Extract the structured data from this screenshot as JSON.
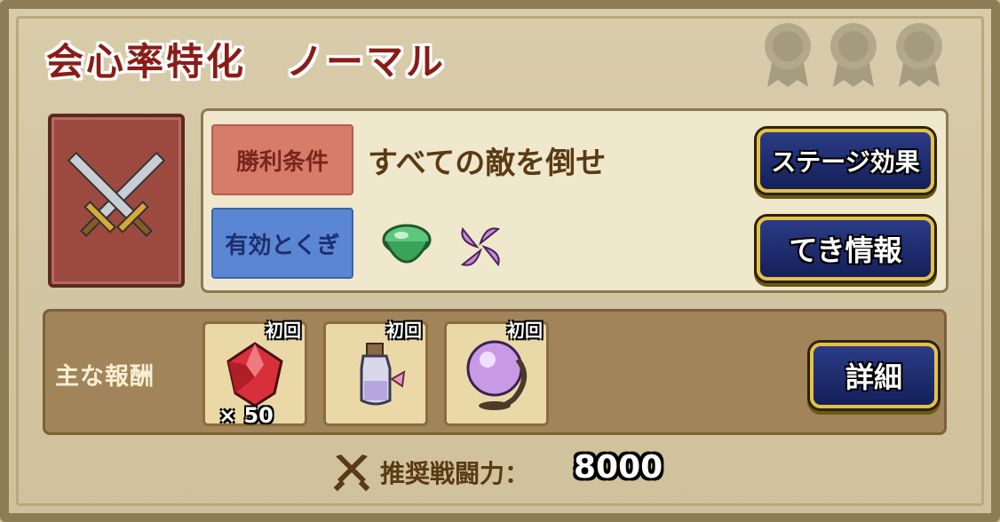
{
  "header": {
    "title": "会心率特化　ノーマル",
    "medals": [
      "medal",
      "medal",
      "medal"
    ]
  },
  "stage": {
    "icon": "crossed-swords-icon"
  },
  "conditions": {
    "win_label": "勝利条件",
    "win_text": "すべての敵を倒せ",
    "skill_label": "有効とくぎ",
    "skills": [
      "green-drop-icon",
      "purple-pinwheel-icon"
    ]
  },
  "buttons": {
    "stage_effect": "ステージ効果",
    "enemy_info": "てき情報",
    "detail": "詳細"
  },
  "rewards": {
    "label": "主な報酬",
    "items": [
      {
        "icon": "red-gem-icon",
        "badge": "初回",
        "qty": "× 50"
      },
      {
        "icon": "potion-bottle-icon",
        "badge": "初回"
      },
      {
        "icon": "crystal-orb-icon",
        "badge": "初回"
      }
    ]
  },
  "power": {
    "label": "推奨戦闘力：",
    "value": "8000"
  },
  "colors": {
    "title": "#8a1c17",
    "win_tag": "#d77c68",
    "skill_tag": "#5a86d3",
    "button_blue": "#1d2c6e",
    "button_gold": "#e4c04a",
    "reward_bar": "#a2845a"
  }
}
